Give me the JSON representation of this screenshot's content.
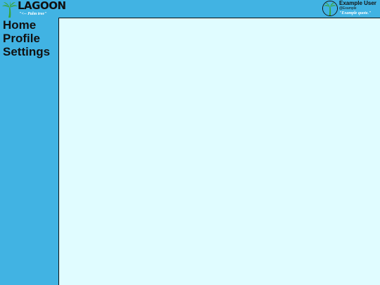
{
  "app": {
    "title": "LAGOON",
    "tagline": "\"<-- Palm tree\""
  },
  "user": {
    "name": "Example User",
    "handle": "@Example",
    "quote": "\"Example quote.\""
  },
  "sidebar": {
    "items": [
      {
        "label": "Home"
      },
      {
        "label": "Profile"
      },
      {
        "label": "Settings"
      }
    ]
  },
  "icons": {
    "logo": "palm-tree-icon",
    "avatar": "palm-tree-avatar-icon"
  },
  "colors": {
    "background": "#41b3e3",
    "content": "#e0fcff",
    "palm": "#3aa535"
  }
}
